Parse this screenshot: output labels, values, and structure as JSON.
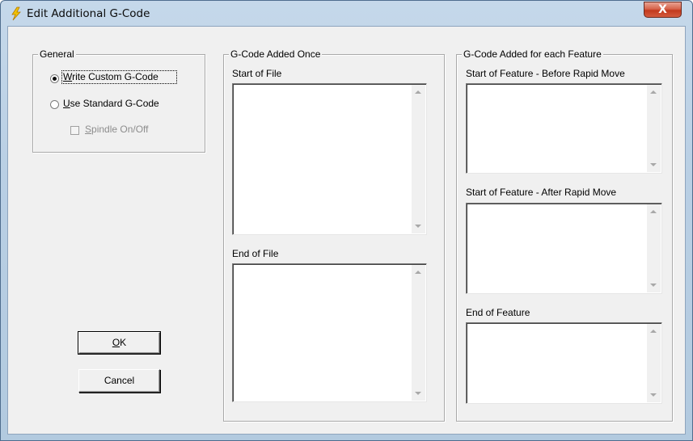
{
  "window": {
    "title": "Edit Additional G-Code",
    "close_glyph": "X",
    "icon": "lightning-bolt-icon",
    "title_icon_color": "#e8b800"
  },
  "general": {
    "label": "General",
    "options": [
      {
        "label": "Write Custom G-Code",
        "mnemonic": "W",
        "selected": true
      },
      {
        "label": "Use Standard G-Code",
        "mnemonic": "U",
        "selected": false
      }
    ],
    "spindle": {
      "label": "Spindle On/Off",
      "mnemonic": "S",
      "checked": false,
      "enabled": false
    }
  },
  "once": {
    "label": "G-Code Added Once",
    "start_label": "Start of File",
    "start_value": "",
    "end_label": "End of File",
    "end_value": ""
  },
  "feature": {
    "label": "G-Code Added for each Feature",
    "before_label": "Start of Feature - Before Rapid Move",
    "before_value": "",
    "after_label": "Start of Feature - After Rapid Move",
    "after_value": "",
    "end_label": "End of Feature",
    "end_value": ""
  },
  "buttons": {
    "ok": "OK",
    "ok_mnemonic": "O",
    "cancel": "Cancel"
  }
}
